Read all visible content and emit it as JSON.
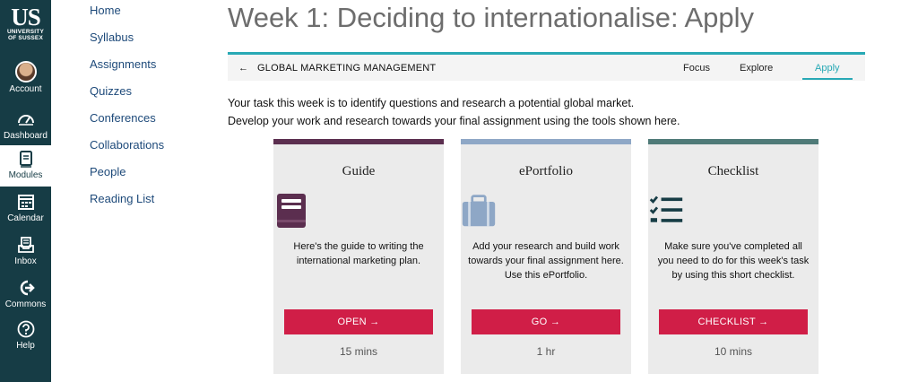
{
  "rail": {
    "logo_mark": "US",
    "logo_line1": "UNIVERSITY",
    "logo_line2": "OF SUSSEX",
    "items": [
      {
        "label": "Account",
        "icon": "avatar-icon"
      },
      {
        "label": "Dashboard",
        "icon": "dashboard-icon"
      },
      {
        "label": "Modules",
        "icon": "modules-icon"
      },
      {
        "label": "Calendar",
        "icon": "calendar-icon"
      },
      {
        "label": "Inbox",
        "icon": "inbox-icon"
      },
      {
        "label": "Commons",
        "icon": "commons-icon"
      },
      {
        "label": "Help",
        "icon": "help-icon"
      }
    ],
    "active": "Modules",
    "colors": {
      "background": "#163c45",
      "text": "#ffffff"
    }
  },
  "course_nav": [
    "Home",
    "Syllabus",
    "Assignments",
    "Quizzes",
    "Conferences",
    "Collaborations",
    "People",
    "Reading List"
  ],
  "page": {
    "title": "Week 1: Deciding to internationalise: Apply",
    "course_name": "GLOBAL MARKETING MANAGEMENT",
    "tabs": [
      "Focus",
      "Explore",
      "Apply"
    ],
    "active_tab": "Apply",
    "intro_line1": "Your task this week is to identify questions and research a potential global market.",
    "intro_line2": "Develop your work and research towards your final assignment using the tools shown here.",
    "accent_color": "#28a9b5"
  },
  "cards": [
    {
      "title": "Guide",
      "icon": "book-icon",
      "desc": "Here's the guide to writing the international marketing plan.",
      "button": "OPEN",
      "time": "15 mins",
      "stripe_color": "#5b2e4f"
    },
    {
      "title": "ePortfolio",
      "icon": "briefcase-icon",
      "desc": "Add your research and build work towards your final assignment here. Use this ePortfolio.",
      "button": "GO",
      "time": "1 hr",
      "stripe_color": "#8ea7c6"
    },
    {
      "title": "Checklist",
      "icon": "checklist-icon",
      "desc": "Make sure you've completed all you need to do for this week's task by using this short checklist.",
      "button": "CHECKLIST",
      "time": "10 mins",
      "stripe_color": "#4f7a78"
    }
  ],
  "button_color": "#d01e47"
}
